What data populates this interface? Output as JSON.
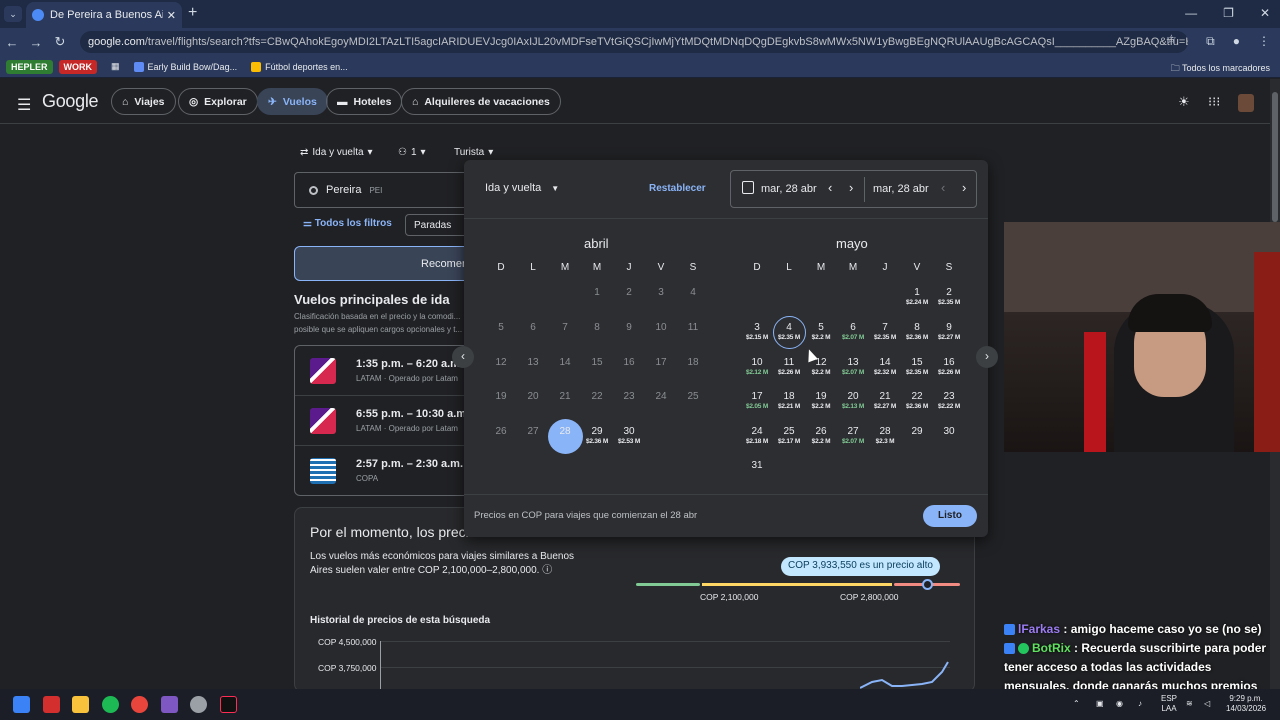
{
  "browser": {
    "tab_title": "De Pereira a Buenos Aires | Vue",
    "url_host": "google.com",
    "url_path": "/travel/flights/search?tfs=CBwQAhokEgoyMDI2LTAzLTI5agcIARIDUEVJcg0IAxIJL20vMDFseTVtGiQSCjIwMjYtMDQtMDNqDQgDEgkvbS8wMWx5NW1yBwgBEgNQRUlAAUgBcAGCAQsI__________AZgBAQ&tfu=EgYIABAAGAA&hl=es-419&gl=co&",
    "bookmarks": [
      {
        "label": "HEPLER",
        "color": "#2e7d32"
      },
      {
        "label": "WORK",
        "color": "#c62828"
      }
    ],
    "bookmark_links": [
      "Early Build Bow/Dag...",
      "Fútbol deportes en..."
    ],
    "bookmarks_folder": "Todos los marcadores"
  },
  "header": {
    "logo": "Google",
    "chips": [
      "Viajes",
      "Explorar",
      "Vuelos",
      "Hoteles",
      "Alquileres de vacaciones"
    ],
    "active_chip": "Vuelos"
  },
  "search": {
    "trip_type": "Ida y vuelta",
    "passengers": "1",
    "cabin": "Turista",
    "origin": "Pereira",
    "origin_code": "PEI",
    "filters_label": "Todos los filtros",
    "stops_label": "Paradas",
    "sort_tab": "Recomen",
    "section_title": "Vuelos principales de ida",
    "section_sub": "Clasificación basada en el precio y la comodi... posible que se apliquen cargos opcionales y t..."
  },
  "flights": [
    {
      "time": "1:35 p.m. – 6:20 a.m.",
      "airline": "LATAM · Operado por Latam",
      "logo": "latam"
    },
    {
      "time": "6:55 p.m. – 10:30 a.m.",
      "airline": "LATAM · Operado por Latam",
      "logo": "latam"
    },
    {
      "time": "2:57 p.m. – 2:30 a.m.",
      "airline": "COPA",
      "logo": "copa"
    }
  ],
  "price_insight": {
    "title": "Por el momento, los precio",
    "text": "Los vuelos más económicos para viajes similares a Buenos Aires suelen valer entre COP 2,100,000–2,800,000.",
    "bubble": "COP 3,933,550 es un precio alto",
    "low_label": "COP 2,100,000",
    "high_label": "COP 2,800,000",
    "history_title": "Historial de precios de esta búsqueda",
    "y_ticks": [
      "COP 4,500,000",
      "COP 3,750,000"
    ]
  },
  "picker": {
    "trip_type": "Ida y vuelta",
    "reset": "Restablecer",
    "depart": "mar, 28 abr",
    "return": "mar, 28 abr",
    "dow": [
      "D",
      "L",
      "M",
      "M",
      "J",
      "V",
      "S"
    ],
    "note": "Precios en COP para viajes que comienzan el 28 abr",
    "done": "Listo",
    "months": [
      {
        "name": "abril",
        "start_col": 3,
        "days": [
          {
            "d": "1"
          },
          {
            "d": "2"
          },
          {
            "d": "3"
          },
          {
            "d": "4"
          },
          {
            "d": "5"
          },
          {
            "d": "6"
          },
          {
            "d": "7"
          },
          {
            "d": "8"
          },
          {
            "d": "9"
          },
          {
            "d": "10"
          },
          {
            "d": "11"
          },
          {
            "d": "12"
          },
          {
            "d": "13"
          },
          {
            "d": "14"
          },
          {
            "d": "15"
          },
          {
            "d": "16"
          },
          {
            "d": "17"
          },
          {
            "d": "18"
          },
          {
            "d": "19"
          },
          {
            "d": "20"
          },
          {
            "d": "21"
          },
          {
            "d": "22"
          },
          {
            "d": "23"
          },
          {
            "d": "24"
          },
          {
            "d": "25"
          },
          {
            "d": "26"
          },
          {
            "d": "27"
          },
          {
            "d": "28",
            "selected": true
          },
          {
            "d": "29",
            "p": "$2.36 M"
          },
          {
            "d": "30",
            "p": "$2.53 M"
          }
        ]
      },
      {
        "name": "mayo",
        "start_col": 5,
        "days": [
          {
            "d": "1",
            "p": "$2.24 M"
          },
          {
            "d": "2",
            "p": "$2.35 M"
          },
          {
            "d": "3",
            "p": "$2.15 M"
          },
          {
            "d": "4",
            "p": "$2.35 M",
            "hover": true
          },
          {
            "d": "5",
            "p": "$2.2 M"
          },
          {
            "d": "6",
            "p": "$2.07 M",
            "cheap": true
          },
          {
            "d": "7",
            "p": "$2.35 M"
          },
          {
            "d": "8",
            "p": "$2.36 M"
          },
          {
            "d": "9",
            "p": "$2.27 M"
          },
          {
            "d": "10",
            "p": "$2.12 M",
            "cheap": true
          },
          {
            "d": "11",
            "p": "$2.26 M"
          },
          {
            "d": "12",
            "p": "$2.2 M"
          },
          {
            "d": "13",
            "p": "$2.07 M",
            "cheap": true
          },
          {
            "d": "14",
            "p": "$2.32 M"
          },
          {
            "d": "15",
            "p": "$2.35 M"
          },
          {
            "d": "16",
            "p": "$2.26 M"
          },
          {
            "d": "17",
            "p": "$2.05 M",
            "cheap": true
          },
          {
            "d": "18",
            "p": "$2.21 M"
          },
          {
            "d": "19",
            "p": "$2.2 M"
          },
          {
            "d": "20",
            "p": "$2.13 M",
            "cheap": true
          },
          {
            "d": "21",
            "p": "$2.27 M"
          },
          {
            "d": "22",
            "p": "$2.36 M"
          },
          {
            "d": "23",
            "p": "$2.22 M"
          },
          {
            "d": "24",
            "p": "$2.18 M"
          },
          {
            "d": "25",
            "p": "$2.17 M"
          },
          {
            "d": "26",
            "p": "$2.2 M"
          },
          {
            "d": "27",
            "p": "$2.07 M",
            "cheap": true
          },
          {
            "d": "28",
            "p": "$2.3 M"
          },
          {
            "d": "29"
          },
          {
            "d": "30"
          },
          {
            "d": "31"
          }
        ]
      }
    ]
  },
  "chat": [
    {
      "user": "lFarkas",
      "msg": ": amigo haceme caso yo se (no se)"
    },
    {
      "user": "BotRix",
      "msg": ": Recuerda suscribirte para poder tener acceso a todas las actividades mensuales, donde ganarás muchos premios"
    }
  ],
  "taskbar": {
    "lang": "ESP",
    "region": "LAA",
    "time": "9:29 p.m.",
    "date": "14/03/2026"
  }
}
